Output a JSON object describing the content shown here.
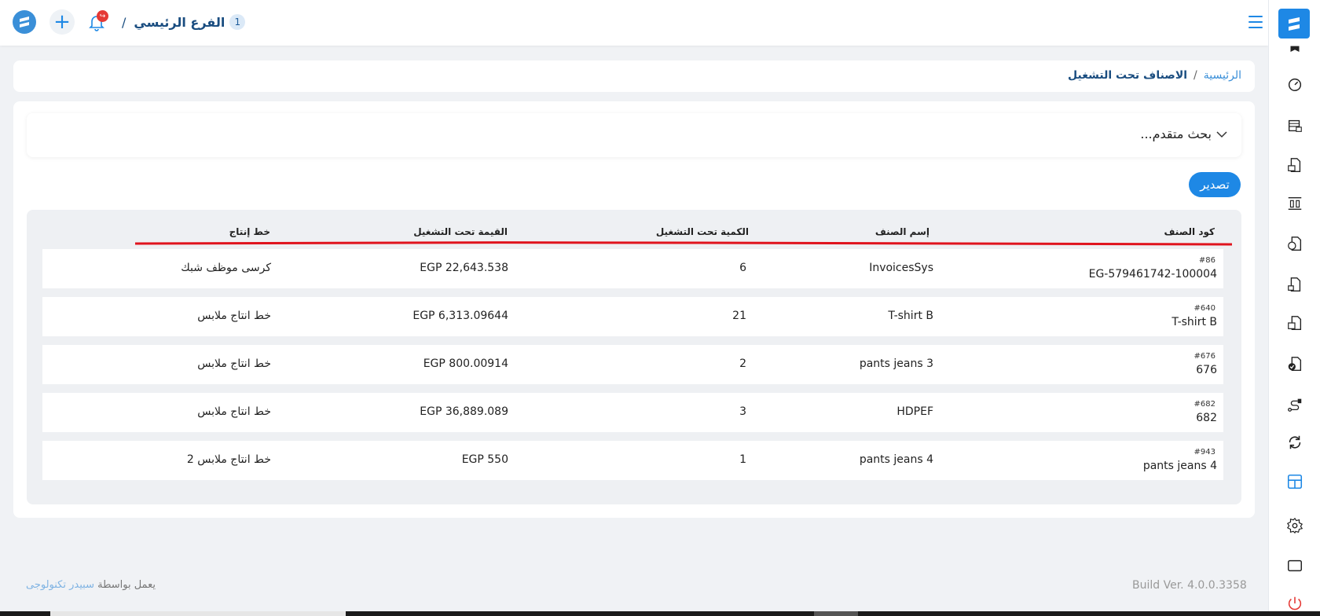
{
  "topbar": {
    "branch_number": "1",
    "branch_name": "الفرع الرئيسي",
    "branch_separator": "/",
    "plus_label": "+",
    "notification_badge": "↪"
  },
  "breadcrumb": {
    "home": "الرئيسية",
    "separator": "/",
    "current": "الاصناف تحت التشغيل"
  },
  "advanced_search": {
    "label": "بحث متقدم..."
  },
  "export_label": "تصدير",
  "table": {
    "columns": {
      "code": "كود الصنف",
      "name": "إسم الصنف",
      "qty": "الكمية تحت التشغيل",
      "value": "القيمة تحت التشغيل",
      "line": "خط إنتاج"
    },
    "rows": [
      {
        "num": "#86",
        "code": "EG-579461742-100004",
        "name": "InvoicesSys",
        "qty": "6",
        "value": "EGP 22,643.538",
        "line": "كرسى موظف شبك"
      },
      {
        "num": "#640",
        "code": "T-shirt B",
        "name": "T-shirt B",
        "qty": "21",
        "value": "EGP 6,313.09644",
        "line": "خط انتاج ملابس"
      },
      {
        "num": "#676",
        "code": "676",
        "name": "pants jeans 3",
        "qty": "2",
        "value": "EGP 800.00914",
        "line": "خط انتاج ملابس"
      },
      {
        "num": "#682",
        "code": "682",
        "name": "HDPEF",
        "qty": "3",
        "value": "EGP 36,889.089",
        "line": "خط انتاج ملابس"
      },
      {
        "num": "#943",
        "code": "pants jeans 4",
        "name": "pants jeans 4",
        "qty": "1",
        "value": "EGP 550",
        "line": "خط انتاج ملابس 2"
      }
    ]
  },
  "footer": {
    "powered_by": "يعمل بواسطة",
    "brand": "سبيدر تكنولوجى",
    "build": "Build Ver. 4.0.0.3358"
  },
  "colors": {
    "accent": "#1e88e5",
    "title": "#1a4d80",
    "annotation": "#e0141e"
  },
  "sidebar_icons": [
    "bookmark-icon",
    "speedometer-icon",
    "warehouse-icon",
    "invoice-icon",
    "columns-icon",
    "money-exchange-icon",
    "document-icon",
    "document-box-icon",
    "document-check-icon",
    "route-icon",
    "refresh-icon",
    "layout-icon",
    "gear-icon",
    "window-icon",
    "power-icon"
  ]
}
